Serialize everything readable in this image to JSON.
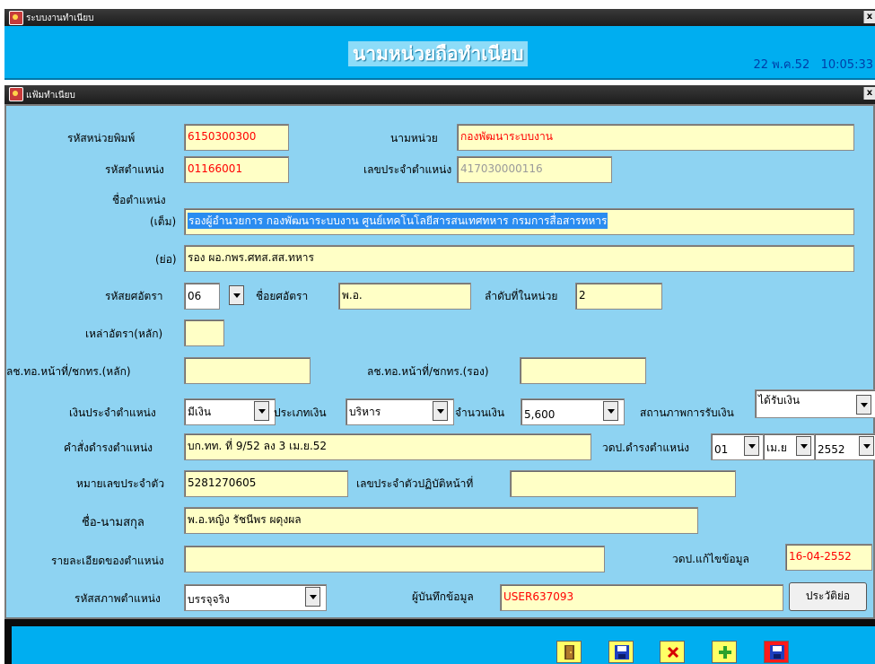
{
  "window": {
    "title": "ระบบงานทำเนียบ",
    "close": "x"
  },
  "header": {
    "title": "นามหน่วยถือทำเนียบ",
    "datetime": "22 พ.ค.52   10:05:33"
  },
  "subwindow": {
    "title": "แฟ้มทำเนียบ",
    "close": "x"
  },
  "form": {
    "print_unit_code": {
      "label": "รหัสหน่วยพิมพ์",
      "value": "6150300300"
    },
    "unit_name": {
      "label": "นามหน่วย",
      "value": "กองพัฒนาระบบงาน"
    },
    "position_code": {
      "label": "รหัสตำแหน่ง",
      "value": "01166001"
    },
    "position_number": {
      "label": "เลขประจำตำแหน่ง",
      "value": "417030000116"
    },
    "position_name": {
      "label": "ชื่อตำแหน่ง"
    },
    "full_name": {
      "label": "(เต็ม)",
      "value": "รองผู้อำนวยการ กองพัฒนาระบบงาน ศูนย์เทคโนโลยีสารสนเทศทหาร กรมการสื่อสารทหาร"
    },
    "short_name": {
      "label": "(ย่อ)",
      "value": "รอง ผอ.กพร.ศทส.สส.ทหาร"
    },
    "rank_code": {
      "label": "รหัสยศอัตรา",
      "value": "06"
    },
    "rank_name": {
      "label": "ชื่อยศอัตรา",
      "value": "พ.อ."
    },
    "order_in_unit": {
      "label": "ลำดับที่ในหน่วย",
      "value": "2"
    },
    "corps": {
      "label": "เหล่าอัตรา(หลัก)",
      "value": ""
    },
    "duty_main": {
      "label": "ลช.ทอ.หน้าที่/ชกทร.(หลัก)",
      "value": ""
    },
    "duty_second": {
      "label": "ลช.ทอ.หน้าที่/ชกทร.(รอง)",
      "value": ""
    },
    "position_pay": {
      "label": "เงินประจำตำแหน่ง",
      "value": "มีเงิน"
    },
    "pay_type": {
      "label": "ประเภทเงิน",
      "value": "บริหาร"
    },
    "amount": {
      "label": "จำนวนเงิน",
      "value": "5,600"
    },
    "pay_status": {
      "label": "สถานภาพการรับเงิน",
      "value": "ได้รับเงิน"
    },
    "appointment_order": {
      "label": "คำสั่งดำรงตำแหน่ง",
      "value": "บก.ทท. ที่ 9/52 ลง 3 เม.ย.52"
    },
    "appointment_date": {
      "label": "วดป.ดำรงตำแหน่ง",
      "day": "01",
      "month": "เม.ย",
      "year": "2552"
    },
    "id_number": {
      "label": "หมายเลขประจำตัว",
      "value": "5281270605"
    },
    "duty_id": {
      "label": "เลขประจำตัวปฏิบัติหน้าที่",
      "value": ""
    },
    "fullname": {
      "label": "ชื่อ-นามสกุล",
      "value": "พ.อ.หญิง รัชนีพร ผดุงผล"
    },
    "position_detail": {
      "label": "รายละเอียดของตำแหน่ง",
      "value": ""
    },
    "edit_date": {
      "label": "วดป.แก้ไขข้อมูล",
      "value": "16-04-2552"
    },
    "position_status": {
      "label": "รหัสสภาพตำแหน่ง",
      "value": "บรรจุจริง"
    },
    "recorder": {
      "label": "ผู้บันทึกข้อมูล",
      "value": "USER637093"
    },
    "history_button": "ประวัติย่อ"
  },
  "toolbar": [
    "exit-icon",
    "save-icon",
    "delete-icon",
    "add-icon",
    "save-red-icon"
  ],
  "colors": {
    "header_bg": "#00aef0",
    "form_bg": "#8ed3f2",
    "field_bg": "#ffffc6",
    "accent_red": "#ff0000",
    "date_blue": "#003ea8"
  }
}
